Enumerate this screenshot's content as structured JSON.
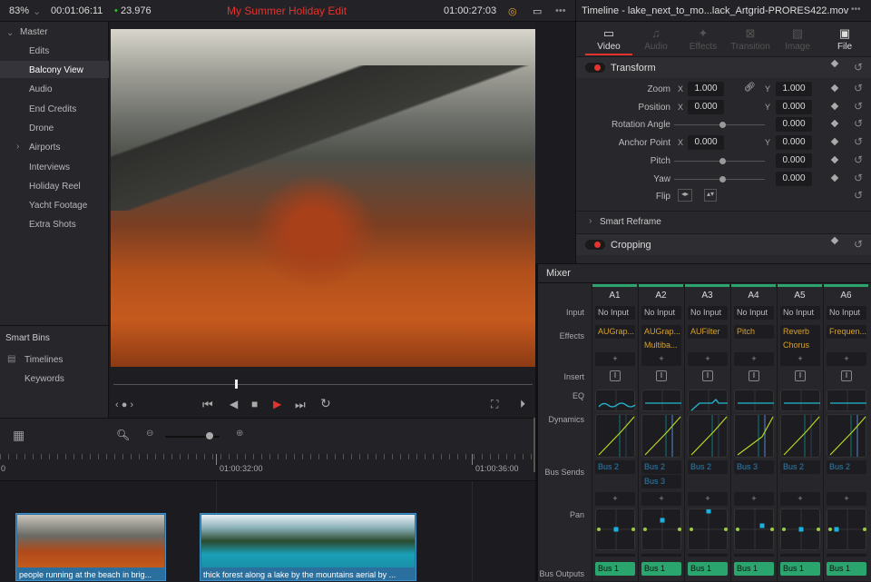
{
  "topbar": {
    "zoom": "83%",
    "duration": "00:01:06:11",
    "fps": "23.976",
    "project_title": "My Summer Holiday Edit",
    "timecode": "01:00:27:03",
    "more": "•••"
  },
  "inspector_header": {
    "title": "Timeline - lake_next_to_mo...lack_Artgrid-PRORES422.mov",
    "more": "•••"
  },
  "inspector_tabs": [
    {
      "label": "Video",
      "icon": "▭"
    },
    {
      "label": "Audio",
      "icon": "♫"
    },
    {
      "label": "Effects",
      "icon": "✦"
    },
    {
      "label": "Transition",
      "icon": "⊠"
    },
    {
      "label": "Image",
      "icon": "▨"
    },
    {
      "label": "File",
      "icon": "▣"
    }
  ],
  "transform": {
    "title": "Transform",
    "zoom_label": "Zoom",
    "zoom_x": "1.000",
    "zoom_y": "1.000",
    "position_label": "Position",
    "position_x": "0.000",
    "position_y": "0.000",
    "rotation_label": "Rotation Angle",
    "rotation": "0.000",
    "anchor_label": "Anchor Point",
    "anchor_x": "0.000",
    "anchor_y": "0.000",
    "pitch_label": "Pitch",
    "pitch": "0.000",
    "yaw_label": "Yaw",
    "yaw": "0.000",
    "flip_label": "Flip",
    "x": "X",
    "y": "Y"
  },
  "smart_reframe": "Smart Reframe",
  "cropping": "Cropping",
  "sidebar": {
    "root": "Master",
    "items": [
      "Edits",
      "Balcony View",
      "Audio",
      "End Credits",
      "Drone",
      "Airports",
      "Interviews",
      "Holiday Reel",
      "Yacht Footage",
      "Extra Shots"
    ],
    "selected": "Balcony View",
    "smart_bins_title": "Smart Bins",
    "smart_bins": [
      "Timelines",
      "Keywords"
    ]
  },
  "viewer": {
    "playhead_fraction": 0.29
  },
  "timeline": {
    "ruler_labels": [
      "0",
      "01:00:32:00",
      "01:00:36:00"
    ],
    "clips": [
      "people running at the beach in brig...",
      "thick forest along a lake by the mountains aerial by ..."
    ]
  },
  "mixer": {
    "title": "Mixer",
    "row_labels": {
      "input": "Input",
      "effects": "Effects",
      "insert": "Insert",
      "eq": "EQ",
      "dynamics": "Dynamics",
      "bus_sends": "Bus Sends",
      "pan": "Pan",
      "bus_outputs": "Bus Outputs"
    },
    "channels": [
      {
        "name": "A1",
        "input": "No Input",
        "effects": [
          "AUGrap..."
        ],
        "insert": "I",
        "sends": [
          "Bus 2"
        ],
        "pan": [
          0,
          0
        ],
        "output": "Bus 1"
      },
      {
        "name": "A2",
        "input": "No Input",
        "effects": [
          "AUGrap...",
          "Multiba..."
        ],
        "insert": "I",
        "sends": [
          "Bus 2",
          "Bus 3"
        ],
        "pan": [
          0,
          0.5
        ],
        "output": "Bus 1"
      },
      {
        "name": "A3",
        "input": "No Input",
        "effects": [
          "AUFilter"
        ],
        "insert": "I",
        "sends": [
          "Bus 2"
        ],
        "pan": [
          0,
          1
        ],
        "output": "Bus 1"
      },
      {
        "name": "A4",
        "input": "No Input",
        "effects": [
          "Pitch"
        ],
        "insert": "I",
        "sends": [
          "Bus 3"
        ],
        "pan": [
          0.4,
          0.2
        ],
        "output": "Bus 1"
      },
      {
        "name": "A5",
        "input": "No Input",
        "effects": [
          "Reverb",
          "Chorus"
        ],
        "insert": "I",
        "sends": [
          "Bus 2"
        ],
        "pan": [
          0,
          0
        ],
        "output": "Bus 1"
      },
      {
        "name": "A6",
        "input": "No Input",
        "effects": [
          "Frequen..."
        ],
        "insert": "I",
        "sends": [
          "Bus 2"
        ],
        "pan": [
          -0.6,
          0
        ],
        "output": "Bus 1"
      }
    ],
    "plus": "+"
  },
  "colors": {
    "accent_red": "#e5322d",
    "bus_green": "#2aa56e",
    "effect_gold": "#d6a12a",
    "send_blue": "#2a7fb0",
    "eq_cyan": "#21b8d0"
  }
}
